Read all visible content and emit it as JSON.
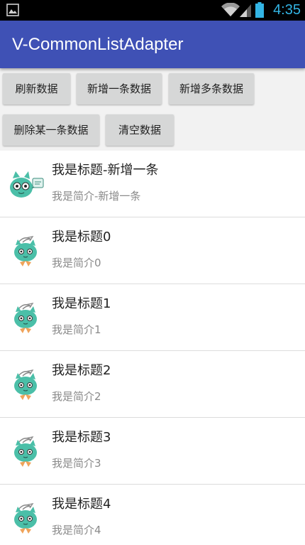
{
  "status_bar": {
    "time": "4:35",
    "icons": [
      "gallery-icon",
      "wifi-icon",
      "signal-icon",
      "battery-icon"
    ]
  },
  "app_bar": {
    "title": "V-CommonListAdapter",
    "color": "#3f51b5"
  },
  "buttons": {
    "refresh": "刷新数据",
    "add_one": "新增一条数据",
    "add_many": "新增多条数据",
    "delete_one": "删除某一条数据",
    "clear": "清空数据"
  },
  "list": {
    "items": [
      {
        "title": "我是标题-新增一条",
        "summary": "我是简介-新增一条",
        "avatar": "cat-with-sign-icon"
      },
      {
        "title": "我是标题0",
        "summary": "我是简介0",
        "avatar": "cat-avatar-icon"
      },
      {
        "title": "我是标题1",
        "summary": "我是简介1",
        "avatar": "cat-avatar-icon"
      },
      {
        "title": "我是标题2",
        "summary": "我是简介2",
        "avatar": "cat-avatar-icon"
      },
      {
        "title": "我是标题3",
        "summary": "我是简介3",
        "avatar": "cat-avatar-icon"
      },
      {
        "title": "我是标题4",
        "summary": "我是简介4",
        "avatar": "cat-avatar-icon"
      }
    ]
  }
}
